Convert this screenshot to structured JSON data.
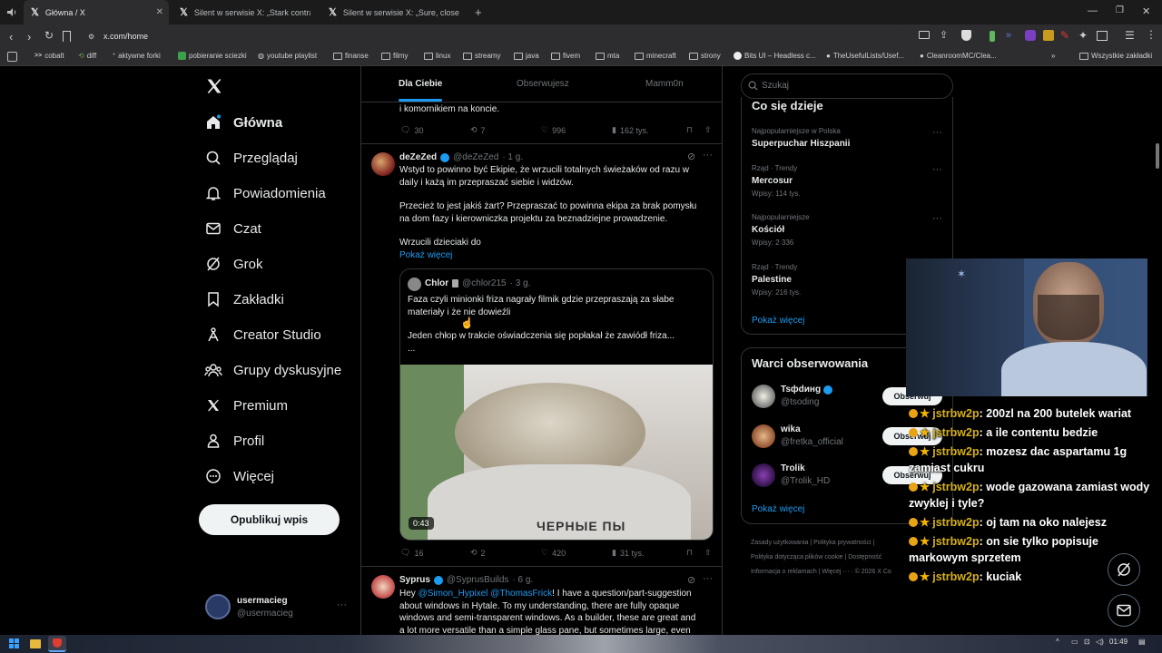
{
  "browser": {
    "tabs": [
      {
        "title": "Główna / X"
      },
      {
        "title": "Silent w serwisie X: „Stark contrast wi"
      },
      {
        "title": "Silent w serwisie X: „Sure, close my P"
      }
    ],
    "url": "x.com/home",
    "bookmarks": [
      "cobalt",
      "diff",
      "aktywne forki",
      "pobieranie sciezki",
      "youtube playlist",
      "finanse",
      "filmy",
      "linux",
      "streamy",
      "java",
      "fivem",
      "mta",
      "minecraft",
      "strony",
      "Bits UI – Headless c...",
      "TheUsefulLists/Usef...",
      "CleanroomMC/Clea..."
    ],
    "bookmarks_other": "Wszystkie zakładki"
  },
  "sidebar": {
    "items": [
      {
        "label": "Główna",
        "icon": "home-icon"
      },
      {
        "label": "Przeglądaj",
        "icon": "search-icon"
      },
      {
        "label": "Powiadomienia",
        "icon": "bell-icon"
      },
      {
        "label": "Czat",
        "icon": "mail-icon"
      },
      {
        "label": "Grok",
        "icon": "grok-icon"
      },
      {
        "label": "Zakładki",
        "icon": "bookmark-icon"
      },
      {
        "label": "Creator Studio",
        "icon": "creator-icon"
      },
      {
        "label": "Grupy dyskusyjne",
        "icon": "groups-icon"
      },
      {
        "label": "Premium",
        "icon": "x-logo-icon"
      },
      {
        "label": "Profil",
        "icon": "person-icon"
      },
      {
        "label": "Więcej",
        "icon": "more-circle-icon"
      }
    ],
    "post_button": "Opublikuj wpis",
    "account": {
      "name": "usermacieg",
      "handle": "@usermacieg"
    }
  },
  "feed": {
    "tabs": [
      "Dla Ciebie",
      "Obserwujesz",
      "Mamm0n"
    ],
    "prev_tweet": {
      "tail": "i komornikiem na koncie.",
      "replies": "30",
      "reposts": "7",
      "likes": "996",
      "views": "162 tys."
    },
    "tweet1": {
      "name": "deZeZed",
      "handle": "@deZeZed",
      "time": "· 1 g.",
      "p1": "Wstyd to powinno być Ekipie, że wrzucili totalnych świeżaków od razu w",
      "p1b": "daily i każą im przepraszać siebie i widzów.",
      "p2": "Przecież to jest jakiś żart? Przepraszać to powinna ekipa za brak pomysłu",
      "p2b": "na dom fazy i kierowniczka projektu za beznadziejne prowadzenie.",
      "p3": "Wrzucili dzieciaki do",
      "show_more": "Pokaż więcej",
      "quote": {
        "name": "Chlor",
        "handle": "@chlor215",
        "time": "· 3 g.",
        "l1": "Faza czyli minionki friza nagrały filmik gdzie przepraszają za słabe",
        "l2": "materiały i że nie dowieźli",
        "l3": "Jeden chłop w trakcie oświadczenia się popłakał że zawiódł friza...",
        "l4": "...",
        "duration": "0:43",
        "video_text": "ЧЕРНЫЕ ПЫ"
      },
      "replies": "16",
      "reposts": "2",
      "likes": "420",
      "views": "31 tys."
    },
    "tweet2": {
      "name": "Syprus",
      "handle": "@SyprusBuilds",
      "time": "· 6 g.",
      "l1a": "Hey ",
      "mention1": "@Simon_Hypixel",
      "mention2": "@ThomasFrick",
      "l1b": "! I have a question/part-suggestion",
      "l2": "about windows in Hytale. To my understanding, there are fully opaque",
      "l3": "windows and semi-transparent windows. As a builder, these are great and",
      "l4": "a lot more versatile than a simple glass pane, but sometimes large, even"
    }
  },
  "right": {
    "search_placeholder": "Szukaj",
    "trends_title": "Co się dzieje",
    "trends": [
      {
        "cat": "Najpopularniejsze w Polska",
        "name": "Superpuchar Hiszpanii",
        "posts": ""
      },
      {
        "cat": "Rząd · Trendy",
        "name": "Mercosur",
        "posts": "Wpisy: 114 tys."
      },
      {
        "cat": "Najpopularniejsze",
        "name": "Kościół",
        "posts": "Wpisy: 2 336"
      },
      {
        "cat": "Rząd · Trendy",
        "name": "Palestine",
        "posts": "Wpisy: 216 tys."
      }
    ],
    "show_more": "Pokaż więcej",
    "wtf_title": "Warci obserwowania",
    "wtf": [
      {
        "name": "Tsфdинg",
        "handle": "@tsoding"
      },
      {
        "name": "wika",
        "handle": "@fretka_official"
      },
      {
        "name": "Trolik",
        "handle": "@Trolik_HD"
      }
    ],
    "follow_label": "Obserwuj",
    "footer1": "Zasady użytkowania  |  Polityka prywatności  |",
    "footer2": "Polityka dotycząca plików cookie  |  Dostępność",
    "footer3": "Informacja o reklamach  |  Więcej ···  ·  © 2026 X Co"
  },
  "chat": [
    {
      "user": "jstrbw2p",
      "msg": ": 200zl na 200 butelek wariat"
    },
    {
      "user": "jstrbw2p",
      "msg": ": a ile contentu bedzie"
    },
    {
      "user": "jstrbw2p",
      "msg": ": mozesz dac aspartamu 1g zamiast cukru"
    },
    {
      "user": "jstrbw2p",
      "msg": ": wode gazowana zamiast wody zwyklej i tyle?"
    },
    {
      "user": "jstrbw2p",
      "msg": ": oj tam na oko nalejesz"
    },
    {
      "user": "jstrbw2p",
      "msg": ": on sie tylko popisuje markowym sprzetem"
    },
    {
      "user": "jstrbw2p",
      "msg": ": kuciak"
    }
  ],
  "taskbar": {
    "time": "01:49"
  }
}
